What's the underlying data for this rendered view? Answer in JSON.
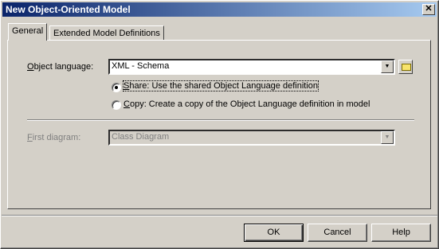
{
  "window": {
    "title": "New Object-Oriented Model",
    "close_glyph": "✕"
  },
  "tabs": [
    {
      "label": "General",
      "active": true
    },
    {
      "label": "Extended Model Definitions",
      "active": false
    }
  ],
  "general": {
    "object_language": {
      "label_mnemonic": "O",
      "label_rest": "bject language:",
      "value": "XML - Schema"
    },
    "share_option": {
      "mnemonic": "S",
      "rest": "hare: Use the shared Object Language definition",
      "selected": true
    },
    "copy_option": {
      "mnemonic": "C",
      "rest": "opy: Create a copy of the Object Language definition in model",
      "selected": false
    },
    "first_diagram": {
      "label_mnemonic": "F",
      "label_rest": "irst diagram:",
      "value": "Class Diagram",
      "disabled": true
    }
  },
  "buttons": {
    "ok": "OK",
    "cancel": "Cancel",
    "help": "Help"
  },
  "colors": {
    "titlebar_start": "#0a246a",
    "titlebar_end": "#a6caf0",
    "face": "#d4d0c8"
  }
}
